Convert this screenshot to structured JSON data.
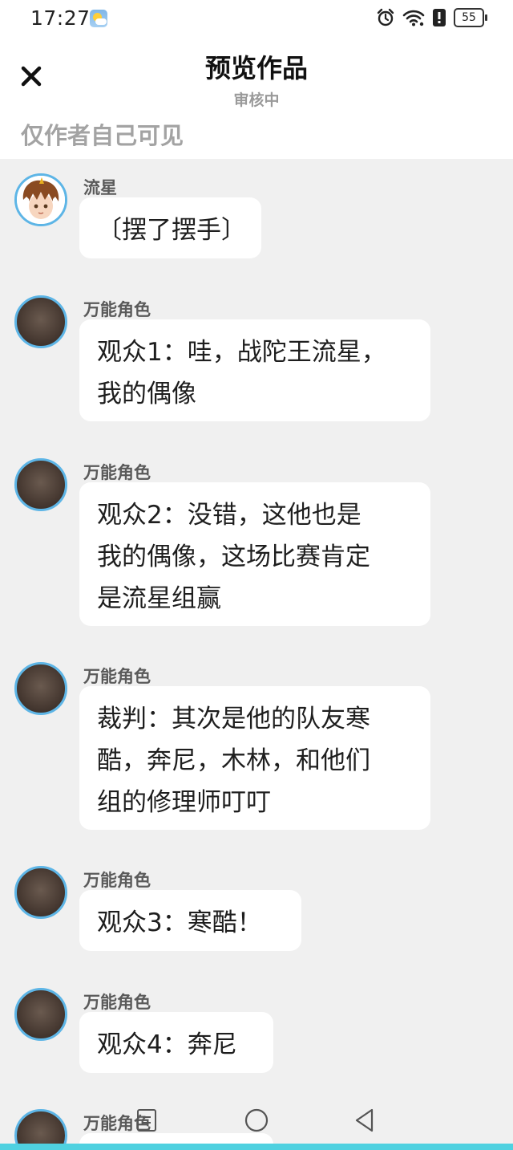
{
  "status_bar": {
    "time": "17:27",
    "battery": "55",
    "icons": [
      "weather-icon",
      "alarm-icon",
      "wifi-icon",
      "alert-icon",
      "battery-icon"
    ]
  },
  "header": {
    "title": "预览作品",
    "subtitle": "审核中",
    "close_icon": "close-icon"
  },
  "visibility_note": "仅作者自己可见",
  "messages": [
    {
      "sender": "流星",
      "text": "〔摆了摆手〕",
      "avatar": "character-avatar"
    },
    {
      "sender": "万能角色",
      "text": "观众1：哇，战陀王流星，\n我的偶像",
      "avatar": "generic-avatar"
    },
    {
      "sender": "万能角色",
      "text": "观众2：没错，这他也是\n我的偶像，这场比赛肯定\n是流星组赢",
      "avatar": "generic-avatar"
    },
    {
      "sender": "万能角色",
      "text": "裁判：其次是他的队友寒\n酷，奔尼，木林，和他们\n组的修理师叮叮",
      "avatar": "generic-avatar"
    },
    {
      "sender": "万能角色",
      "text": "观众3：寒酷！",
      "avatar": "generic-avatar"
    },
    {
      "sender": "万能角色",
      "text": "观众4：奔尼",
      "avatar": "generic-avatar"
    },
    {
      "sender": "万能角色",
      "text": "",
      "avatar": "generic-avatar"
    }
  ],
  "navbar": {
    "icons": [
      "recent-apps-icon",
      "home-icon",
      "back-icon"
    ]
  },
  "colors": {
    "background": "#f0f0f0",
    "bubble": "#ffffff",
    "avatar_ring": "#5db5e6",
    "accent_strip": "#4fd1e0"
  }
}
